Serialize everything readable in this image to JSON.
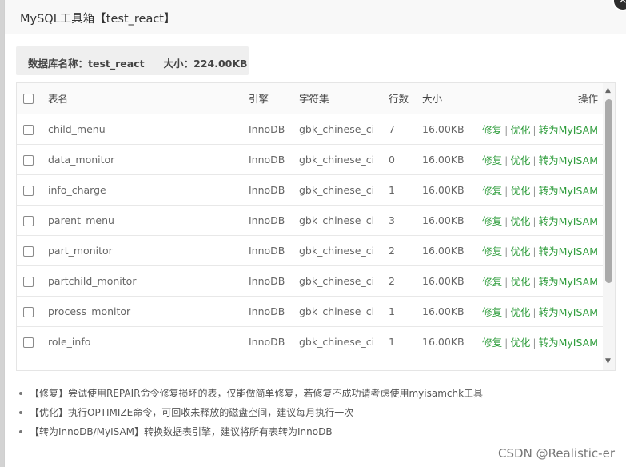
{
  "dialog": {
    "title": "MySQL工具箱【test_react】",
    "close_symbol": "×"
  },
  "info": {
    "db_label": "数据库名称：",
    "db_name": "test_react",
    "size_label": "大小：",
    "size_value": "224.00KB"
  },
  "table": {
    "headers": {
      "name": "表名",
      "engine": "引擎",
      "charset": "字符集",
      "rows": "行数",
      "size": "大小",
      "ops": "操作"
    },
    "op_labels": {
      "repair": "修复",
      "optimize": "优化",
      "convert": "转为MyISAM",
      "separator": "|"
    },
    "rows": [
      {
        "name": "child_menu",
        "engine": "InnoDB",
        "charset": "gbk_chinese_ci",
        "rows": "7",
        "size": "16.00KB"
      },
      {
        "name": "data_monitor",
        "engine": "InnoDB",
        "charset": "gbk_chinese_ci",
        "rows": "0",
        "size": "16.00KB"
      },
      {
        "name": "info_charge",
        "engine": "InnoDB",
        "charset": "gbk_chinese_ci",
        "rows": "1",
        "size": "16.00KB"
      },
      {
        "name": "parent_menu",
        "engine": "InnoDB",
        "charset": "gbk_chinese_ci",
        "rows": "3",
        "size": "16.00KB"
      },
      {
        "name": "part_monitor",
        "engine": "InnoDB",
        "charset": "gbk_chinese_ci",
        "rows": "2",
        "size": "16.00KB"
      },
      {
        "name": "partchild_monitor",
        "engine": "InnoDB",
        "charset": "gbk_chinese_ci",
        "rows": "2",
        "size": "16.00KB"
      },
      {
        "name": "process_monitor",
        "engine": "InnoDB",
        "charset": "gbk_chinese_ci",
        "rows": "1",
        "size": "16.00KB"
      },
      {
        "name": "role_info",
        "engine": "InnoDB",
        "charset": "gbk_chinese_ci",
        "rows": "1",
        "size": "16.00KB"
      }
    ]
  },
  "notes": [
    "【修复】尝试使用REPAIR命令修复损坏的表，仅能做简单修复，若修复不成功请考虑使用myisamchk工具",
    "【优化】执行OPTIMIZE命令，可回收未释放的磁盘空间，建议每月执行一次",
    "【转为InnoDB/MyISAM】转换数据表引擎，建议将所有表转为InnoDB"
  ],
  "watermark": "CSDN @Realistic-er",
  "icons": {
    "scroll_up": "▲",
    "scroll_down": "▼"
  },
  "colors": {
    "op_link": "#2e9c3b",
    "close_button": "#2e2e2e"
  }
}
